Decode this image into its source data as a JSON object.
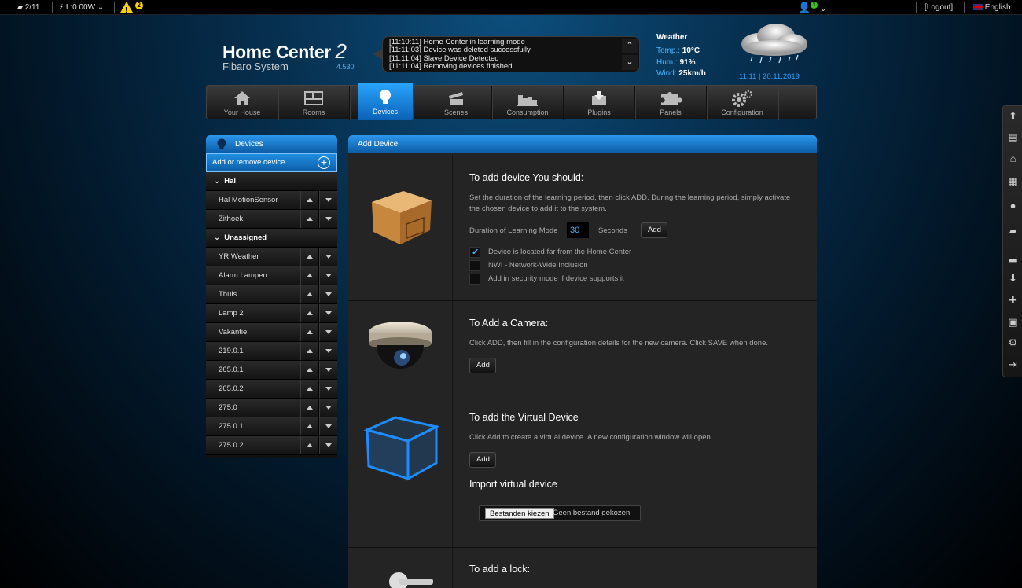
{
  "topbar": {
    "devices_count": "2/11",
    "power": "L:0.00W",
    "warnings_count": "2",
    "user_badge": "1",
    "logout": "[Logout]",
    "language": "English"
  },
  "header": {
    "logo_title": "Home Center",
    "logo_number": "2",
    "logo_subtitle": "Fibaro System",
    "version": "4.530",
    "log_lines": [
      "[11:10:11] Home Center in learning mode",
      "[11:11:03] Device was deleted successfully",
      "[11:11:04] Slave Device Detected",
      "[11:11:04] Removing devices finished"
    ],
    "weather": {
      "title": "Weather",
      "temp_label": "Temp.:",
      "temp_value": "10°C",
      "hum_label": "Hum.:",
      "hum_value": "91%",
      "wind_label": "Wind:",
      "wind_value": "25km/h",
      "icon": "rain-cloud-icon"
    },
    "clock": "11:11 | 20.11.2019"
  },
  "nav": {
    "tabs": [
      {
        "label": "Your House",
        "icon": "house-icon"
      },
      {
        "label": "Rooms",
        "icon": "rooms-icon"
      },
      {
        "label": "Devices",
        "icon": "bulb-icon",
        "active": true
      },
      {
        "label": "Scenes",
        "icon": "clapper-icon"
      },
      {
        "label": "Consumption",
        "icon": "chart-icon"
      },
      {
        "label": "Plugins",
        "icon": "download-box-icon"
      },
      {
        "label": "Panels",
        "icon": "puzzle-icon"
      },
      {
        "label": "Configuration",
        "icon": "gear-icon"
      }
    ]
  },
  "sidebar": {
    "title": "Devices",
    "add_label": "Add or remove device",
    "groups": [
      {
        "name": "Hal",
        "items": [
          "Hal MotionSensor",
          "Zithoek"
        ]
      },
      {
        "name": "Unassigned",
        "items": [
          "YR Weather",
          "Alarm Lampen",
          "Thuis",
          "Lamp 2",
          "Vakantie",
          "219.0.1",
          "265.0.1",
          "265.0.2",
          "275.0",
          "275.0.1",
          "275.0.2"
        ]
      }
    ]
  },
  "panel": {
    "title": "Add Device",
    "device": {
      "heading": "To add device You should:",
      "desc": "Set the duration of the learning period, then click ADD. During the learning period, simply activate the chosen device to add it to the system.",
      "duration_label": "Duration of Learning Mode",
      "duration_value": "30",
      "seconds_label": "Seconds",
      "add_label": "Add",
      "options": [
        {
          "label": "Device is located far from the Home Center",
          "checked": true
        },
        {
          "label": "NWI - Network-Wide Inclusion",
          "checked": false
        },
        {
          "label": "Add in security mode if device supports it",
          "checked": false
        }
      ]
    },
    "camera": {
      "heading": "To Add a Camera:",
      "desc": "Click ADD, then fill in the configuration details for the new camera. Click SAVE when done.",
      "add_label": "Add"
    },
    "virtual": {
      "heading": "To add the Virtual Device",
      "desc": "Click Add to create a virtual device. A new configuration window will open.",
      "add_label": "Add",
      "import_heading": "Import virtual device",
      "file_button": "Bestanden kiezen",
      "file_status": "Geen bestand gekozen"
    },
    "lock": {
      "heading": "To add a lock:"
    }
  }
}
